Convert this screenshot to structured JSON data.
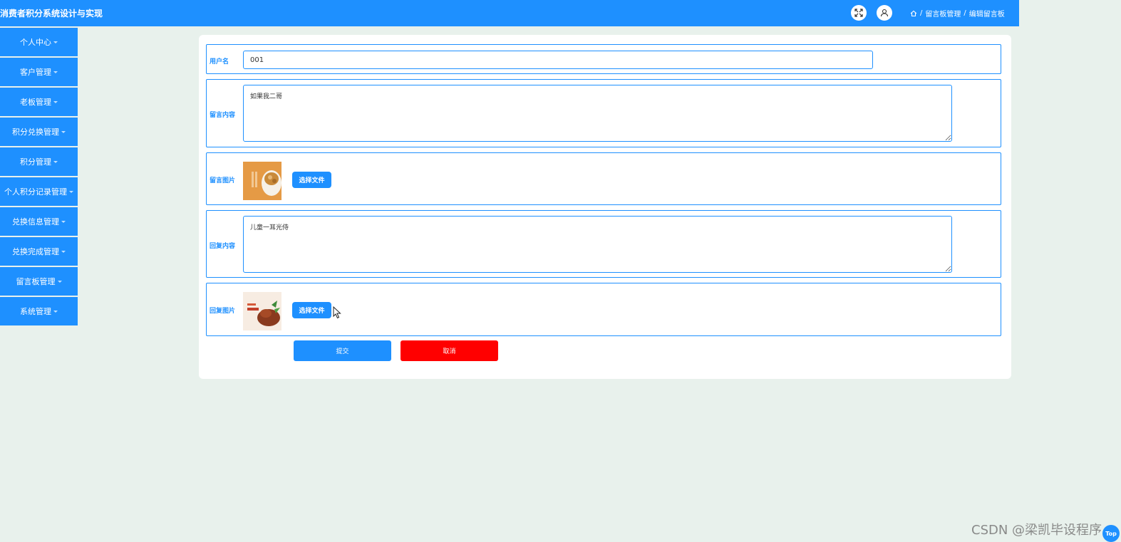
{
  "header": {
    "title": "消费者积分系统设计与实现",
    "breadcrumb": [
      "留言板管理",
      "编辑留言板"
    ],
    "breadcrumb_sep": "/",
    "icons": {
      "fullscreen": "fullscreen-icon",
      "user": "user-icon",
      "home": "home-icon"
    }
  },
  "sidebar": {
    "items": [
      {
        "label": "个人中心"
      },
      {
        "label": "客户管理"
      },
      {
        "label": "老板管理"
      },
      {
        "label": "积分兑换管理"
      },
      {
        "label": "积分管理"
      },
      {
        "label": "个人积分记录管理"
      },
      {
        "label": "兑换信息管理"
      },
      {
        "label": "兑换完成管理"
      },
      {
        "label": "留言板管理"
      },
      {
        "label": "系统管理"
      }
    ]
  },
  "form": {
    "username": {
      "label": "用户名",
      "value": "001"
    },
    "message_content": {
      "label": "留言内容",
      "value": "如果我二哥"
    },
    "message_image": {
      "label": "留言图片",
      "button": "选择文件"
    },
    "reply_content": {
      "label": "回复内容",
      "value": "儿童一耳光侍"
    },
    "reply_image": {
      "label": "回复图片",
      "button": "选择文件"
    },
    "submit": "提交",
    "cancel": "取消"
  },
  "watermark": "CSDN @梁凯毕设程序",
  "top_button": "Top",
  "colors": {
    "primary": "#1e90ff",
    "danger": "#ff0000",
    "background": "#e8f1ec"
  }
}
